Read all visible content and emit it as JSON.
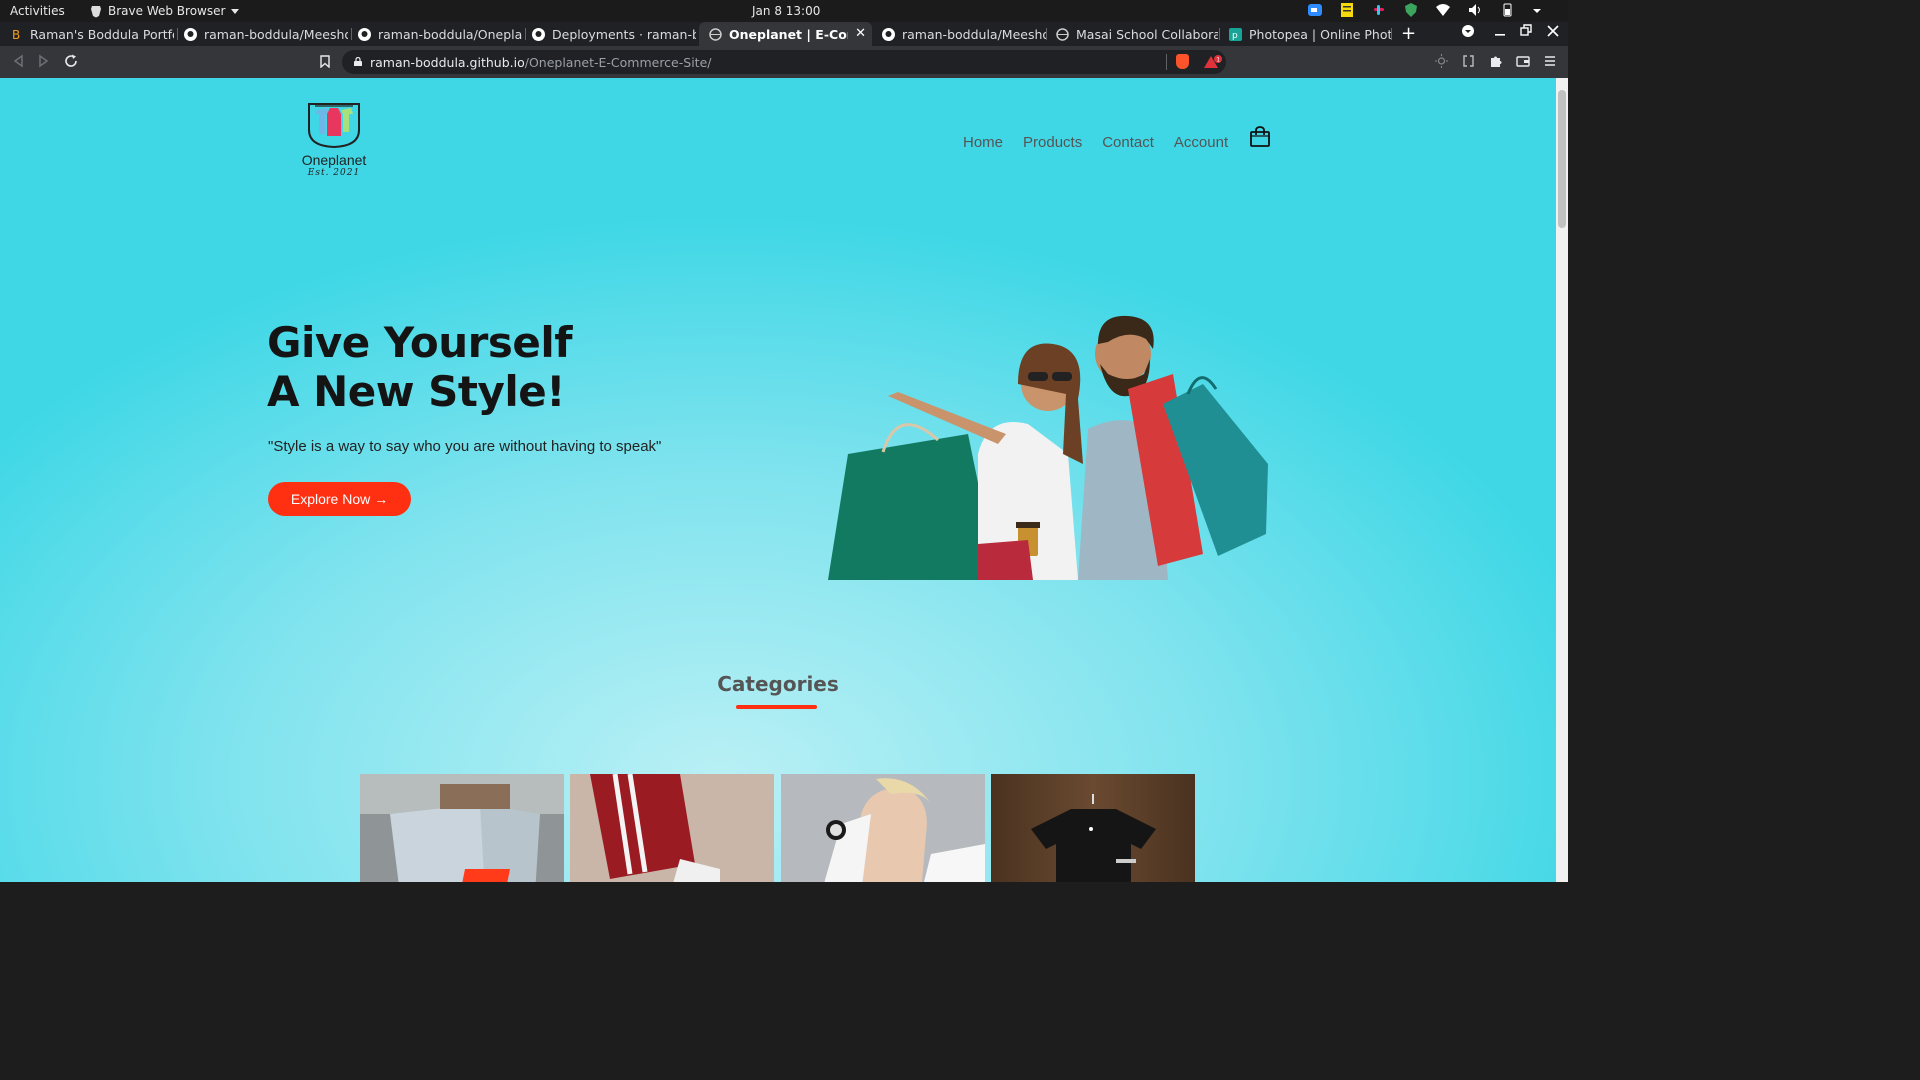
{
  "system_bar": {
    "activities": "Activities",
    "app_name": "Brave Web Browser",
    "clock": "Jan 8  13:00"
  },
  "tabs": [
    {
      "label": "Raman's Boddula Portfoli",
      "icon": "portfolio-icon",
      "active": false
    },
    {
      "label": "raman-boddula/Meesho:",
      "icon": "github-icon",
      "active": false
    },
    {
      "label": "raman-boddula/Oneplane",
      "icon": "github-icon",
      "active": false
    },
    {
      "label": "Deployments · raman-bod",
      "icon": "github-icon",
      "active": false
    },
    {
      "label": "Oneplanet | E-Comme",
      "icon": "globe-icon",
      "active": true
    },
    {
      "label": "raman-boddula/Meesho:",
      "icon": "github-icon",
      "active": false
    },
    {
      "label": "Masai School Collaboratic",
      "icon": "globe-icon",
      "active": false
    },
    {
      "label": "Photopea | Online Photo",
      "icon": "photopea-icon",
      "active": false
    }
  ],
  "address_bar": {
    "host": "raman-boddula.github.io",
    "path": "/Oneplanet-E-Commerce-Site/",
    "rewards_badge": "1"
  },
  "site": {
    "logo_name": "Oneplanet",
    "logo_est": "Est. 2021",
    "nav": {
      "home": "Home",
      "products": "Products",
      "contact": "Contact",
      "account": "Account"
    },
    "hero": {
      "line1": "Give Yourself",
      "line2": "A New Style!",
      "quote": "\"Style is a way to say who you are without having to speak\"",
      "cta": "Explore Now →"
    },
    "categories_title": "Categories"
  },
  "colors": {
    "accent": "#ff2f12",
    "page_bg": "#3fd7e6",
    "heading": "#141414"
  }
}
